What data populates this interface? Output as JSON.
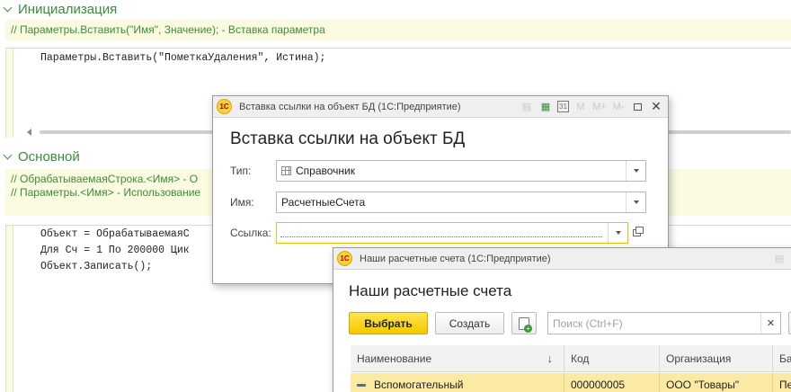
{
  "editor": {
    "section1": {
      "title": "Инициализация",
      "comment": "// Параметры.Вставить(\"Имя\", Значение); - Вставка параметра",
      "code": [
        "Параметры.Вставить(\"ПометкаУдаления\", Истина);"
      ]
    },
    "section2": {
      "title": "Основной",
      "comments": [
        "// ОбрабатываемаяСтрока.<Имя> - О",
        "// Параметры.<Имя> - Использование"
      ],
      "code": [
        "Объект = ОбрабатываемаяС",
        "Для Сч = 1 По 200000 Цик",
        "Объект.Записать();"
      ]
    }
  },
  "insert_dialog": {
    "window_title": "Вставка ссылки на объект БД  (1С:Предприятие)",
    "logo_text": "1С",
    "heading": "Вставка ссылки на объект БД",
    "fields": {
      "type": {
        "label": "Тип:",
        "value": "Справочник"
      },
      "name": {
        "label": "Имя:",
        "value": "РасчетныеСчета"
      },
      "link": {
        "label": "Ссылка:",
        "value": ""
      }
    },
    "toolbar": {
      "m": "M",
      "m_plus": "M+",
      "m_minus": "M-",
      "calendar_day": "31"
    }
  },
  "accounts_window": {
    "window_title": "Наши расчетные счета  (1С:Предприятие)",
    "logo_text": "1С",
    "heading": "Наши расчетные счета",
    "buttons": {
      "select": "Выбрать",
      "create": "Создать"
    },
    "search_placeholder": "Поиск (Ctrl+F)",
    "columns": [
      "Наименование",
      "Код",
      "Организация",
      "Ба"
    ],
    "rows": [
      {
        "name": "Вспомогательный",
        "code": "000000005",
        "org": "ООО \"Товары\"",
        "bank": "Пе"
      }
    ]
  }
}
